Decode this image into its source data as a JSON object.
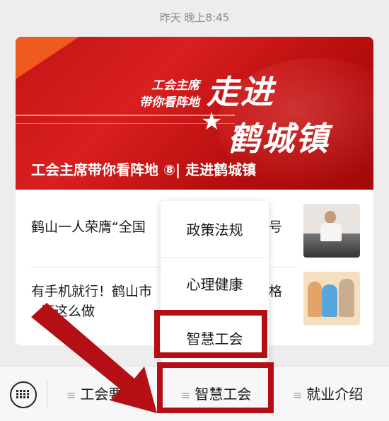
{
  "timestamp": "昨天 晚上8:45",
  "banner": {
    "subtitle_line1": "工会主席",
    "subtitle_line2": "带你看阵地",
    "big_line1": "走进",
    "big_line2": "鹤城镇",
    "caption": "工会主席带你看阵地 ⑧| 走进鹤城镇"
  },
  "articles": [
    {
      "title": "鹤山一人荣膺“全国",
      "title_tail": "号",
      "thumb": "man-with-motorcycle-photo"
    },
    {
      "title": "有手机就行！鹤山市",
      "title_tail": "格",
      "title_line2": "证这么做",
      "thumb": "cartoon-family-illustration"
    }
  ],
  "popup_menu": {
    "items": [
      "政策法规",
      "心理健康",
      "智慧工会"
    ]
  },
  "bottom_bar": {
    "keyboard_icon": "keyboard-icon",
    "tabs": [
      "工会要闻",
      "智慧工会",
      "就业介绍"
    ]
  },
  "colors": {
    "banner_red": "#c51414",
    "highlight_red": "#b40f14",
    "background": "#ededed"
  }
}
